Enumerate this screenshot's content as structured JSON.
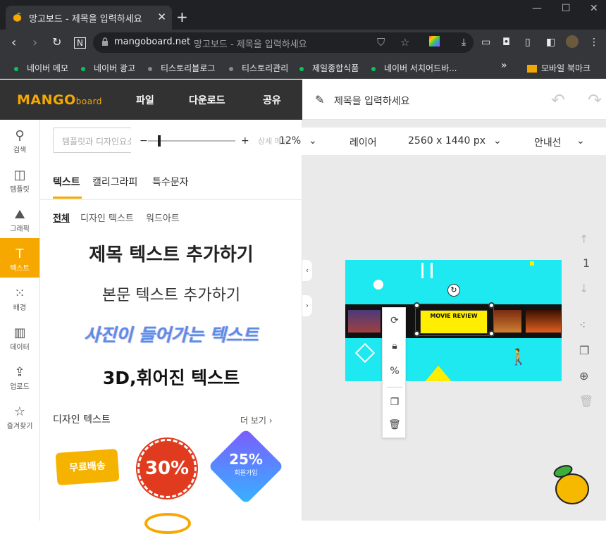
{
  "browser": {
    "tab_title": "망고보드 - 제목을 입력하세요",
    "url_host": "mangoboard.net",
    "url_title": "망고보드 - 제목을 입력하세요",
    "bookmarks": [
      "네이버 메모",
      "네이버 광고",
      "티스토리블로그",
      "티스토리관리",
      "제일종합식품",
      "네이버 서치어드바..."
    ],
    "bookmarks_more": "»",
    "mobile_bookmarks": "모바일 북마크"
  },
  "app": {
    "logo_main": "MANGO",
    "logo_sub": "board",
    "menu": [
      "파일",
      "다운로드",
      "공유"
    ],
    "doc_title": "제목을 입력하세요"
  },
  "rail": [
    "검색",
    "템플릿",
    "그래픽",
    "텍스트",
    "배경",
    "데이터",
    "업로드",
    "즐겨찾기"
  ],
  "panel": {
    "search_placeholder": "템플릿과 디자인요소 바로찾기...",
    "tabs": [
      "텍스트",
      "캘리그라피",
      "특수문자"
    ],
    "subtabs": [
      "전체",
      "디자인 텍스트",
      "워드아트"
    ],
    "samples": [
      "제목 텍스트 추가하기",
      "본문 텍스트 추가하기",
      "사진이 들어가는 텍스트",
      "3D,휘어진 텍스트"
    ],
    "design_heading": "디자인 텍스트",
    "more": "더 보기",
    "stickers": [
      "무료배송",
      "30%",
      "25%",
      "회원가입"
    ]
  },
  "controls": {
    "detail": "상세 메뉴",
    "zoom": "12%",
    "layer": "레이어",
    "size": "2560 x 1440 px",
    "guide": "안내선",
    "minus": "−",
    "plus": "+"
  },
  "canvas": {
    "movie_title": "MOVIE REVIEW",
    "page_number": "1"
  },
  "colors": {
    "brand": "#f7a800",
    "canvas_bg": "#1ee8f0"
  }
}
